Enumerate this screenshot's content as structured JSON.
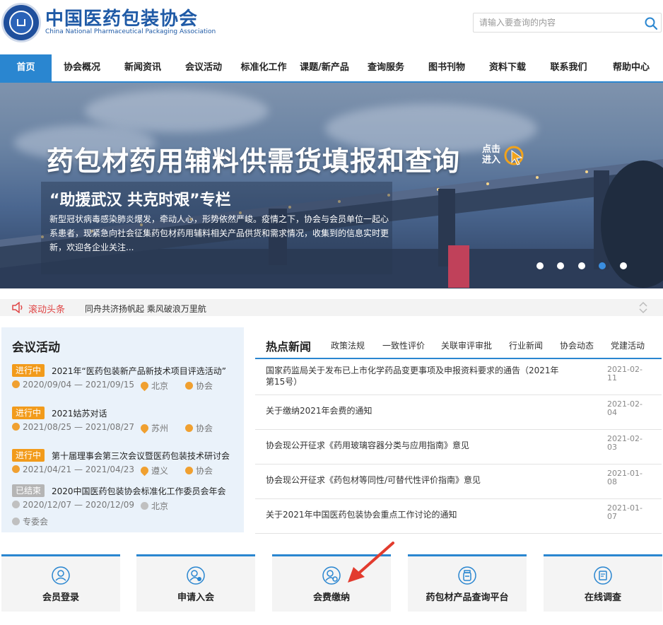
{
  "header": {
    "title": "中国医药包装协会",
    "subtitle": "China National Pharmaceutical Packaging Association",
    "logo_seal": "中国医药包装协会 China National Pharmaceutical Packaging Association",
    "search_placeholder": "请输入要查询的内容",
    "search_icon": "search-icon"
  },
  "nav": {
    "items": [
      {
        "label": "首页",
        "active": true
      },
      {
        "label": "协会概况"
      },
      {
        "label": "新闻资讯"
      },
      {
        "label": "会议活动"
      },
      {
        "label": "标准化工作"
      },
      {
        "label": "课题/新产品"
      },
      {
        "label": "查询服务"
      },
      {
        "label": "图书刊物"
      },
      {
        "label": "资料下载"
      },
      {
        "label": "联系我们"
      },
      {
        "label": "帮助中心"
      }
    ],
    "accent": "#2a86d0"
  },
  "banner": {
    "headline": "药包材药用辅料供需货填报和查询",
    "click_line1": "点击",
    "click_line2": "进入",
    "subtitle": "“助援武汉 共克时艰”专栏",
    "description": "新型冠状病毒感染肺炎爆发，牵动人心，形势依然严峻。疫情之下，协会与会员单位一起心系患者，现紧急向社会征集药包材药用辅料相关产品供货和需求情况，收集到的信息实时更新，欢迎各企业关注...",
    "slides": 5,
    "active_slide": 3
  },
  "ticker": {
    "label": "滚动头条",
    "text": "同舟共济扬帆起 乘风破浪万里航",
    "label_color": "#e04646"
  },
  "events": {
    "title": "会议活动",
    "items": [
      {
        "status": "进行中",
        "state": "on",
        "title": "2021年“医药包装新产品新技术项目评选活动”",
        "date": "2020/09/04 — 2021/09/15",
        "place": "北京",
        "org": "协会"
      },
      {
        "status": "进行中",
        "state": "on",
        "title": "2021姑苏对话",
        "date": "2021/08/25 — 2021/08/27",
        "place": "苏州",
        "org": "协会"
      },
      {
        "status": "进行中",
        "state": "on",
        "title": "第十届理事会第三次会议暨医药包装技术研讨会",
        "date": "2021/04/21 — 2021/04/23",
        "place": "遵义",
        "org": "协会"
      },
      {
        "status": "已结束",
        "state": "off",
        "title": "2020中国医药包装协会标准化工作委员会年会",
        "date": "2020/12/07 — 2020/12/09",
        "place": "北京",
        "org": "专委会"
      }
    ],
    "status_color_on": "#f29b1b",
    "status_color_off": "#b5b5b5"
  },
  "news": {
    "title": "热点新闻",
    "tabs": [
      "政策法规",
      "一致性评价",
      "关联审评审批",
      "行业新闻",
      "协会动态",
      "党建活动"
    ],
    "rows": [
      {
        "text": "国家药监局关于发布已上市化学药品变更事项及申报资料要求的通告（2021年 第15号）",
        "date": "2021-02-11"
      },
      {
        "text": "关于缴纳2021年会费的通知",
        "date": "2021-02-04"
      },
      {
        "text": "协会现公开征求《药用玻璃容器分类与应用指南》意见",
        "date": "2021-02-03"
      },
      {
        "text": "协会现公开征求《药包材等同性/可替代性评价指南》意见",
        "date": "2021-01-08"
      },
      {
        "text": "关于2021年中国医药包装协会重点工作讨论的通知",
        "date": "2021-01-07"
      }
    ]
  },
  "quick_links": [
    {
      "label": "会员登录",
      "icon": "vip-user-icon"
    },
    {
      "label": "申请入会",
      "icon": "add-user-icon"
    },
    {
      "label": "会费缴纳",
      "icon": "user-coin-icon"
    },
    {
      "label": "药包材产品查询平台",
      "icon": "bottle-icon"
    },
    {
      "label": "在线调查",
      "icon": "survey-icon"
    }
  ],
  "annotation": {
    "red_arrow_color": "#e23b2e"
  }
}
